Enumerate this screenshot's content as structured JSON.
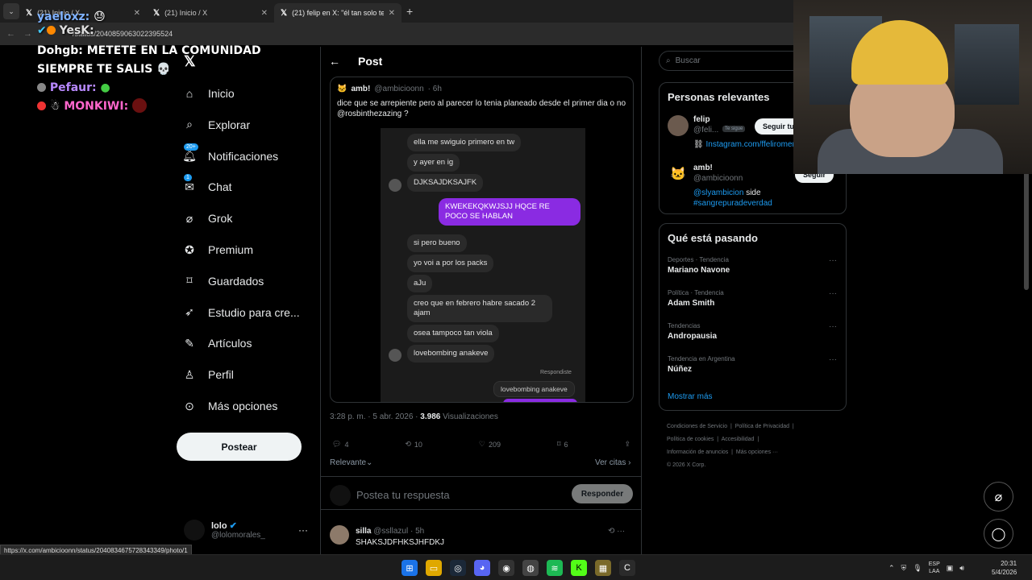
{
  "browser": {
    "tabs": [
      {
        "title": "(21) Inicio / X"
      },
      {
        "title": "(21) Inicio / X"
      },
      {
        "title": "(21) felip en X: \"él tan solo tenía"
      }
    ],
    "url": "/status/2040859063022395524",
    "status_url": "https://x.com/ambicioonn/status/2040834675728343349/photo/1"
  },
  "stream_chat": {
    "lines": [
      {
        "user": "yaeloxz:",
        "msg": ""
      },
      {
        "user": "YesK:",
        "msg": ""
      },
      {
        "user": "Dohgb:",
        "msg": "METETE EN LA COMUNIDAD SIEMPRE TE SALIS"
      },
      {
        "user": "Pefaur:",
        "msg": ""
      },
      {
        "user": "MONKIWI:",
        "msg": ""
      }
    ]
  },
  "nav": {
    "items": [
      {
        "label": "Inicio",
        "icon": "home-icon"
      },
      {
        "label": "Explorar",
        "icon": "search-icon"
      },
      {
        "label": "Notificaciones",
        "icon": "bell-icon",
        "badge": "20+"
      },
      {
        "label": "Chat",
        "icon": "chat-icon",
        "badge": "1"
      },
      {
        "label": "Grok",
        "icon": "grok-icon"
      },
      {
        "label": "Premium",
        "icon": "premium-icon"
      },
      {
        "label": "Guardados",
        "icon": "bookmark-icon"
      },
      {
        "label": "Estudio para cre...",
        "icon": "rocket-icon"
      },
      {
        "label": "Artículos",
        "icon": "article-icon"
      },
      {
        "label": "Perfil",
        "icon": "person-icon"
      },
      {
        "label": "Más opciones",
        "icon": "more-icon"
      }
    ],
    "post_button": "Postear",
    "me": {
      "name": "lolo",
      "handle": "@lolomorales_"
    }
  },
  "post": {
    "header": "Post",
    "quote": {
      "name": "amb!",
      "handle": "@ambicioonn",
      "time": "· 6h",
      "text": "dice que se arrepiente pero al parecer lo tenia planeado desde el primer dia o no @rosbinthezazing ?",
      "screenshot": {
        "messages": [
          "ella me swiguio primero en tw",
          "y ayer en ig",
          "DJKSAJDKSAJFK",
          "KWEKEKQKWJSJJ HQCE RE POCO SE HABLAN",
          "si pero bueno",
          "yo voi a por los packs",
          "aJu",
          "creo que en febrero habre sacado 2 ajam",
          "osea tampoco tan viola",
          "lovebombing anakeve"
        ],
        "respondiste": "Respondiste",
        "reply": "lovebombing anakeve"
      }
    },
    "time": "3:28 p. m. · 5 abr. 2026 ·",
    "views": "3.986",
    "views_label": "Visualizaciones",
    "counts": {
      "replies": "4",
      "reposts": "10",
      "likes": "209",
      "bookmarks": "6"
    },
    "relevante": "Relevante",
    "ver_citas": "Ver citas",
    "reply_placeholder": "Postea tu respuesta",
    "reply_button": "Responder",
    "comment": {
      "name": "silla",
      "handle": "@ssllazul",
      "time": "· 5h",
      "text": "SHAKSJDFHKSJHFDKJ"
    }
  },
  "right": {
    "search_placeholder": "Buscar",
    "relevant_title": "Personas relevantes",
    "people": [
      {
        "name": "felip",
        "handle": "@feli...",
        "follows": "Te sigue",
        "bio": "Instagram.com/ffeliromer",
        "button": "Seguir tu"
      },
      {
        "name": "amb!",
        "handle": "@ambicioonn",
        "bio_mention": "@slyambicion",
        "bio_word": "side",
        "bio_tag": "#sangrepuradeverdad",
        "button": "Seguir"
      }
    ],
    "trends_title": "Qué está pasando",
    "trends": [
      {
        "category": "Deportes · Tendencia",
        "name": "Mariano Navone"
      },
      {
        "category": "Política · Tendencia",
        "name": "Adam Smith"
      },
      {
        "category": "Tendencias",
        "name": "Andropausia"
      },
      {
        "category": "Tendencia en Argentina",
        "name": "Núñez"
      }
    ],
    "show_more": "Mostrar más",
    "footer": [
      "Condiciones de Servicio",
      "Política de Privacidad",
      "Política de cookies",
      "Accesibilidad",
      "Información de anuncios",
      "Más opciones ···",
      "© 2026 X Corp."
    ]
  },
  "taskbar": {
    "lang_top": "ESP",
    "lang_bottom": "LAA",
    "time": "20:31",
    "date": "5/4/2026"
  }
}
